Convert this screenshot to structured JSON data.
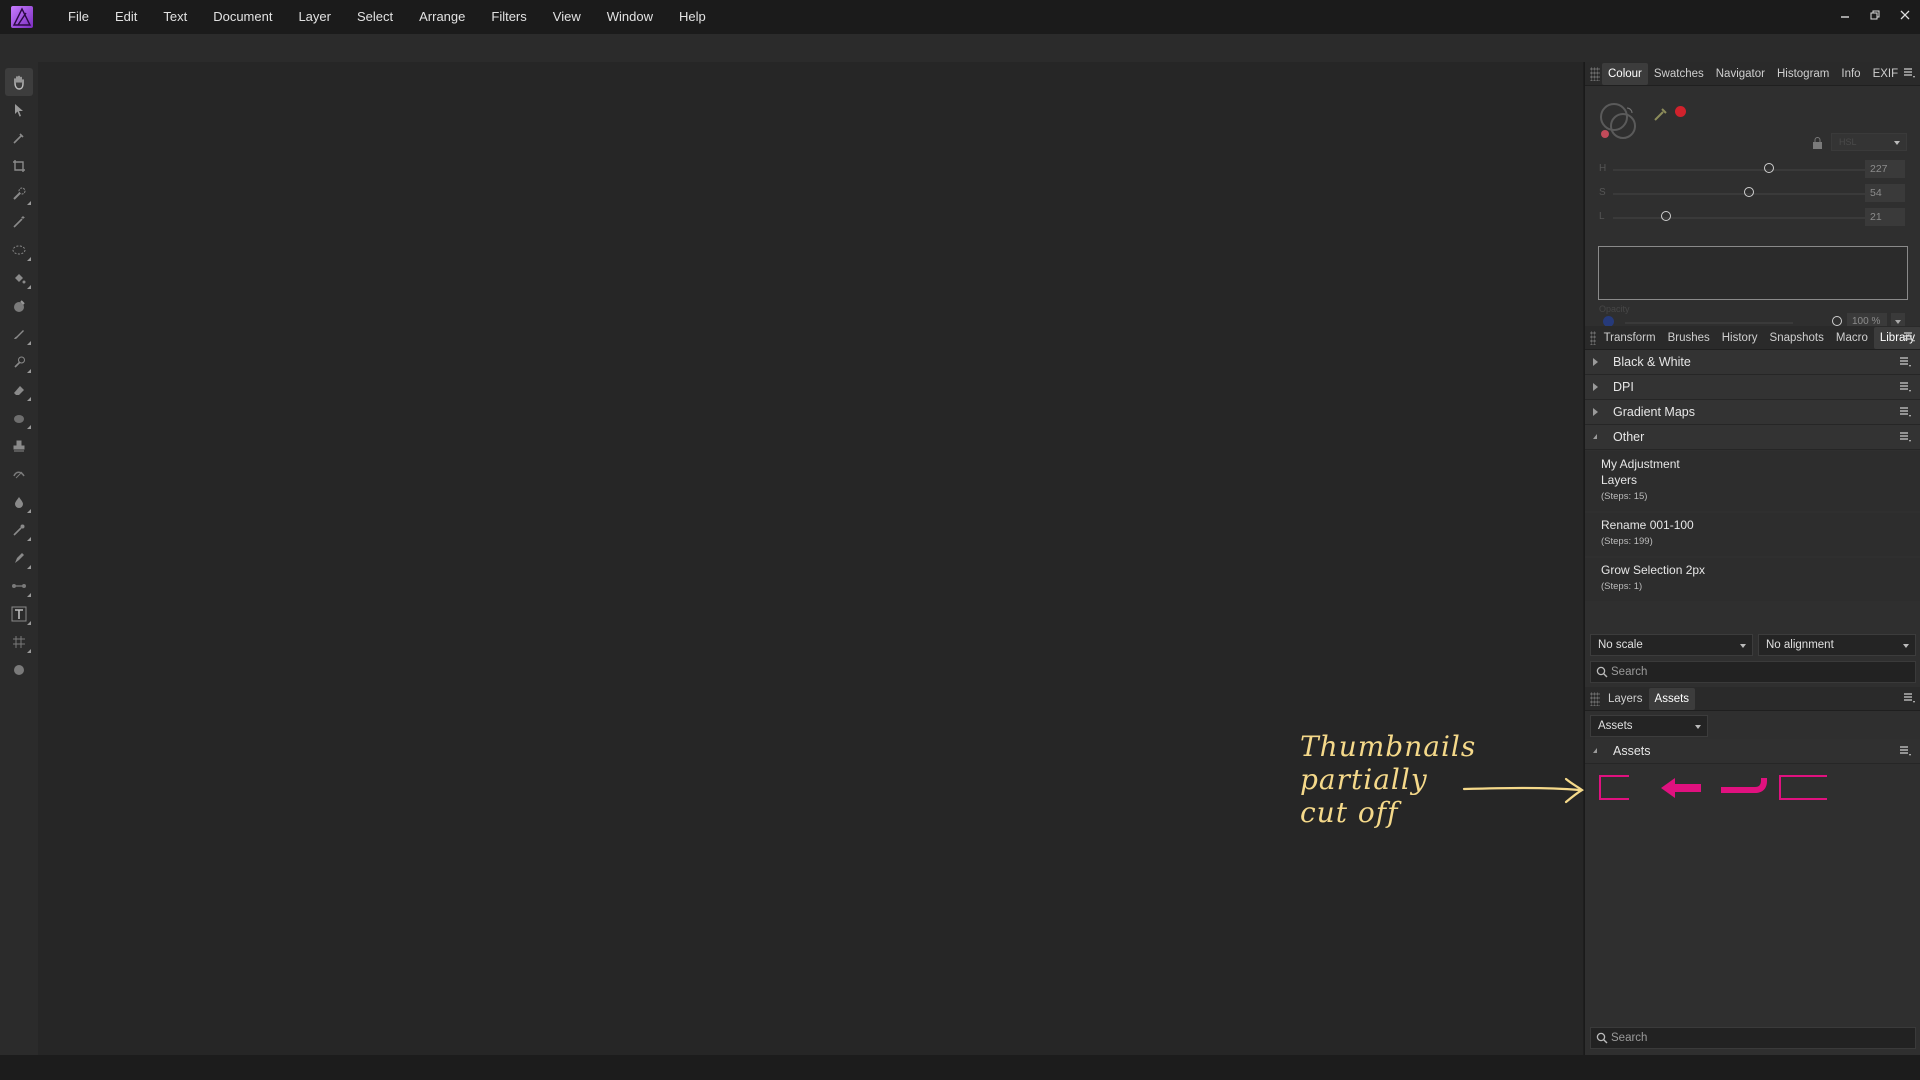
{
  "menu": [
    "File",
    "Edit",
    "Text",
    "Document",
    "Layer",
    "Select",
    "Arrange",
    "Filters",
    "View",
    "Window",
    "Help"
  ],
  "colors": {
    "accent": "#e0117f",
    "annotation": "#f5d98a",
    "primary_fill": "#d0222c",
    "secondary_fill": "#263a7a"
  },
  "colour_panel": {
    "tabs": [
      "Colour",
      "Swatches",
      "Navigator",
      "Histogram",
      "Info",
      "EXIF"
    ],
    "active_tab": "Colour",
    "model": "HSL",
    "sliders": [
      {
        "label": "H",
        "value": "227",
        "fraction": 0.62
      },
      {
        "label": "S",
        "value": "54",
        "fraction": 0.54
      },
      {
        "label": "L",
        "value": "21",
        "fraction": 0.21
      }
    ],
    "opacity_label": "Opacity",
    "opacity_value": "100 %"
  },
  "library_panel": {
    "tabs": [
      "Transform",
      "Brushes",
      "History",
      "Snapshots",
      "Macro",
      "Library"
    ],
    "active_tab": "Library",
    "categories": [
      "Black & White",
      "DPI",
      "Gradient Maps",
      "Other"
    ],
    "macros": [
      {
        "name_line1": "My Adjustment",
        "name_line2": "Layers",
        "steps": "(Steps: 15)"
      },
      {
        "name_line1": "Rename 001-100",
        "name_line2": "",
        "steps": "(Steps: 199)"
      },
      {
        "name_line1": "Grow Selection 2px",
        "name_line2": "",
        "steps": "(Steps: 1)"
      }
    ],
    "scale_dropdown": "No scale",
    "alignment_dropdown": "No alignment",
    "search_placeholder": "Search"
  },
  "assets_panel": {
    "tabs": [
      "Layers",
      "Assets"
    ],
    "active_tab": "Assets",
    "dropdown": "Assets",
    "category": "Assets",
    "search_placeholder": "Search"
  },
  "annotation": {
    "line1": "Thumbnails",
    "line2": "partially",
    "line3": "cut off"
  }
}
